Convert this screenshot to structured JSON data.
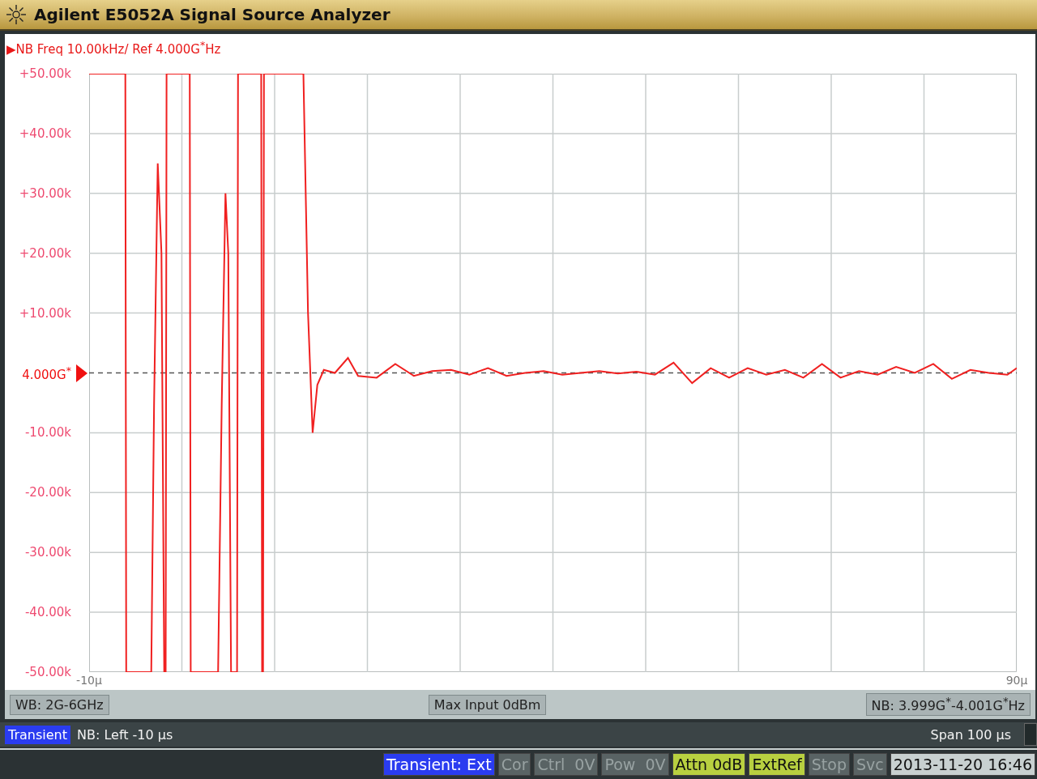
{
  "window": {
    "title": "Agilent E5052A Signal Source Analyzer"
  },
  "trace_label": "▶NB Freq 10.00kHz/ Ref 4.000G$^{*}$Hz",
  "chart": {
    "chart_data": {
      "type": "line",
      "grid": true,
      "xlim": [
        -10,
        90
      ],
      "ylim": [
        -50,
        50
      ],
      "xticks": [
        {
          "value": -10,
          "label": "-10μ"
        },
        {
          "value": 90,
          "label": "90μ"
        }
      ],
      "yticks": [
        {
          "value": 50,
          "label": "+50.00k"
        },
        {
          "value": 40,
          "label": "+40.00k"
        },
        {
          "value": 30,
          "label": "+30.00k"
        },
        {
          "value": 20,
          "label": "+20.00k"
        },
        {
          "value": 10,
          "label": "+10.00k"
        },
        {
          "value": -10,
          "label": "-10.00k"
        },
        {
          "value": -20,
          "label": "-20.00k"
        },
        {
          "value": -30,
          "label": "-30.00k"
        },
        {
          "value": -40,
          "label": "-40.00k"
        },
        {
          "value": -50,
          "label": "-50.00k"
        }
      ],
      "ref_lines": [
        {
          "axis": "y",
          "value": 0,
          "label": "4.000G$^{*}$"
        }
      ],
      "x": [
        -10,
        -6.1,
        -6.0,
        -3.3,
        -3.0,
        -2.6,
        -2.2,
        -1.9,
        -1.75,
        -1.65,
        0.85,
        0.95,
        3.9,
        4.3,
        4.7,
        5.0,
        5.3,
        5.95,
        6.05,
        8.55,
        8.65,
        8.75,
        8.85,
        13.1,
        13.6,
        14.1,
        14.6,
        15.3,
        16.5,
        17.9,
        19,
        21,
        23,
        25,
        27,
        29,
        31,
        33,
        35,
        37,
        39,
        41,
        43,
        45,
        47,
        49,
        51,
        53,
        55,
        57,
        59,
        61,
        63,
        65,
        67,
        69,
        71,
        73,
        75,
        77,
        79,
        81,
        83,
        85,
        87,
        89,
        90
      ],
      "series": [
        {
          "color": "#f02020",
          "values": [
            50,
            50,
            -50,
            -50,
            -5,
            35,
            20,
            -50,
            -50,
            50,
            50,
            -50,
            -50,
            -5,
            30,
            20,
            -50,
            -50,
            50,
            50,
            -50,
            -50,
            50,
            50,
            10,
            -10,
            -2,
            0.5,
            0,
            2.5,
            -0.5,
            -0.8,
            1.5,
            -0.5,
            0.3,
            0.5,
            -0.3,
            0.8,
            -0.5,
            0,
            0.3,
            -0.3,
            0,
            0.3,
            -0.1,
            0.2,
            -0.3,
            1.7,
            -1.7,
            0.8,
            -0.8,
            0.8,
            -0.3,
            0.5,
            -0.8,
            1.5,
            -0.8,
            0.3,
            -0.3,
            1.0,
            0,
            1.5,
            -1.0,
            0.5,
            0,
            -0.3,
            0.8
          ]
        }
      ]
    }
  },
  "wb_bar": {
    "left": "WB: 2G-6GHz",
    "center": "Max Input 0dBm",
    "right": "NB: 3.999G$^{*}$-4.001G$^{*}$Hz"
  },
  "info_bar": {
    "mode": "Transient",
    "left": "NB: Left -10 μs",
    "right": "Span 100 μs"
  },
  "status_bar": [
    {
      "text": "Transient: Ext",
      "kind": "mode"
    },
    {
      "text": "Cor",
      "kind": "off"
    },
    {
      "text": "Ctrl  0V",
      "kind": "off"
    },
    {
      "text": "Pow  0V",
      "kind": "off"
    },
    {
      "text": "Attn 0dB",
      "kind": "lit"
    },
    {
      "text": "ExtRef",
      "kind": "lit"
    },
    {
      "text": "Stop",
      "kind": "off"
    },
    {
      "text": "Svc",
      "kind": "off"
    },
    {
      "text": "2013-11-20 16:46",
      "kind": "clock"
    }
  ]
}
